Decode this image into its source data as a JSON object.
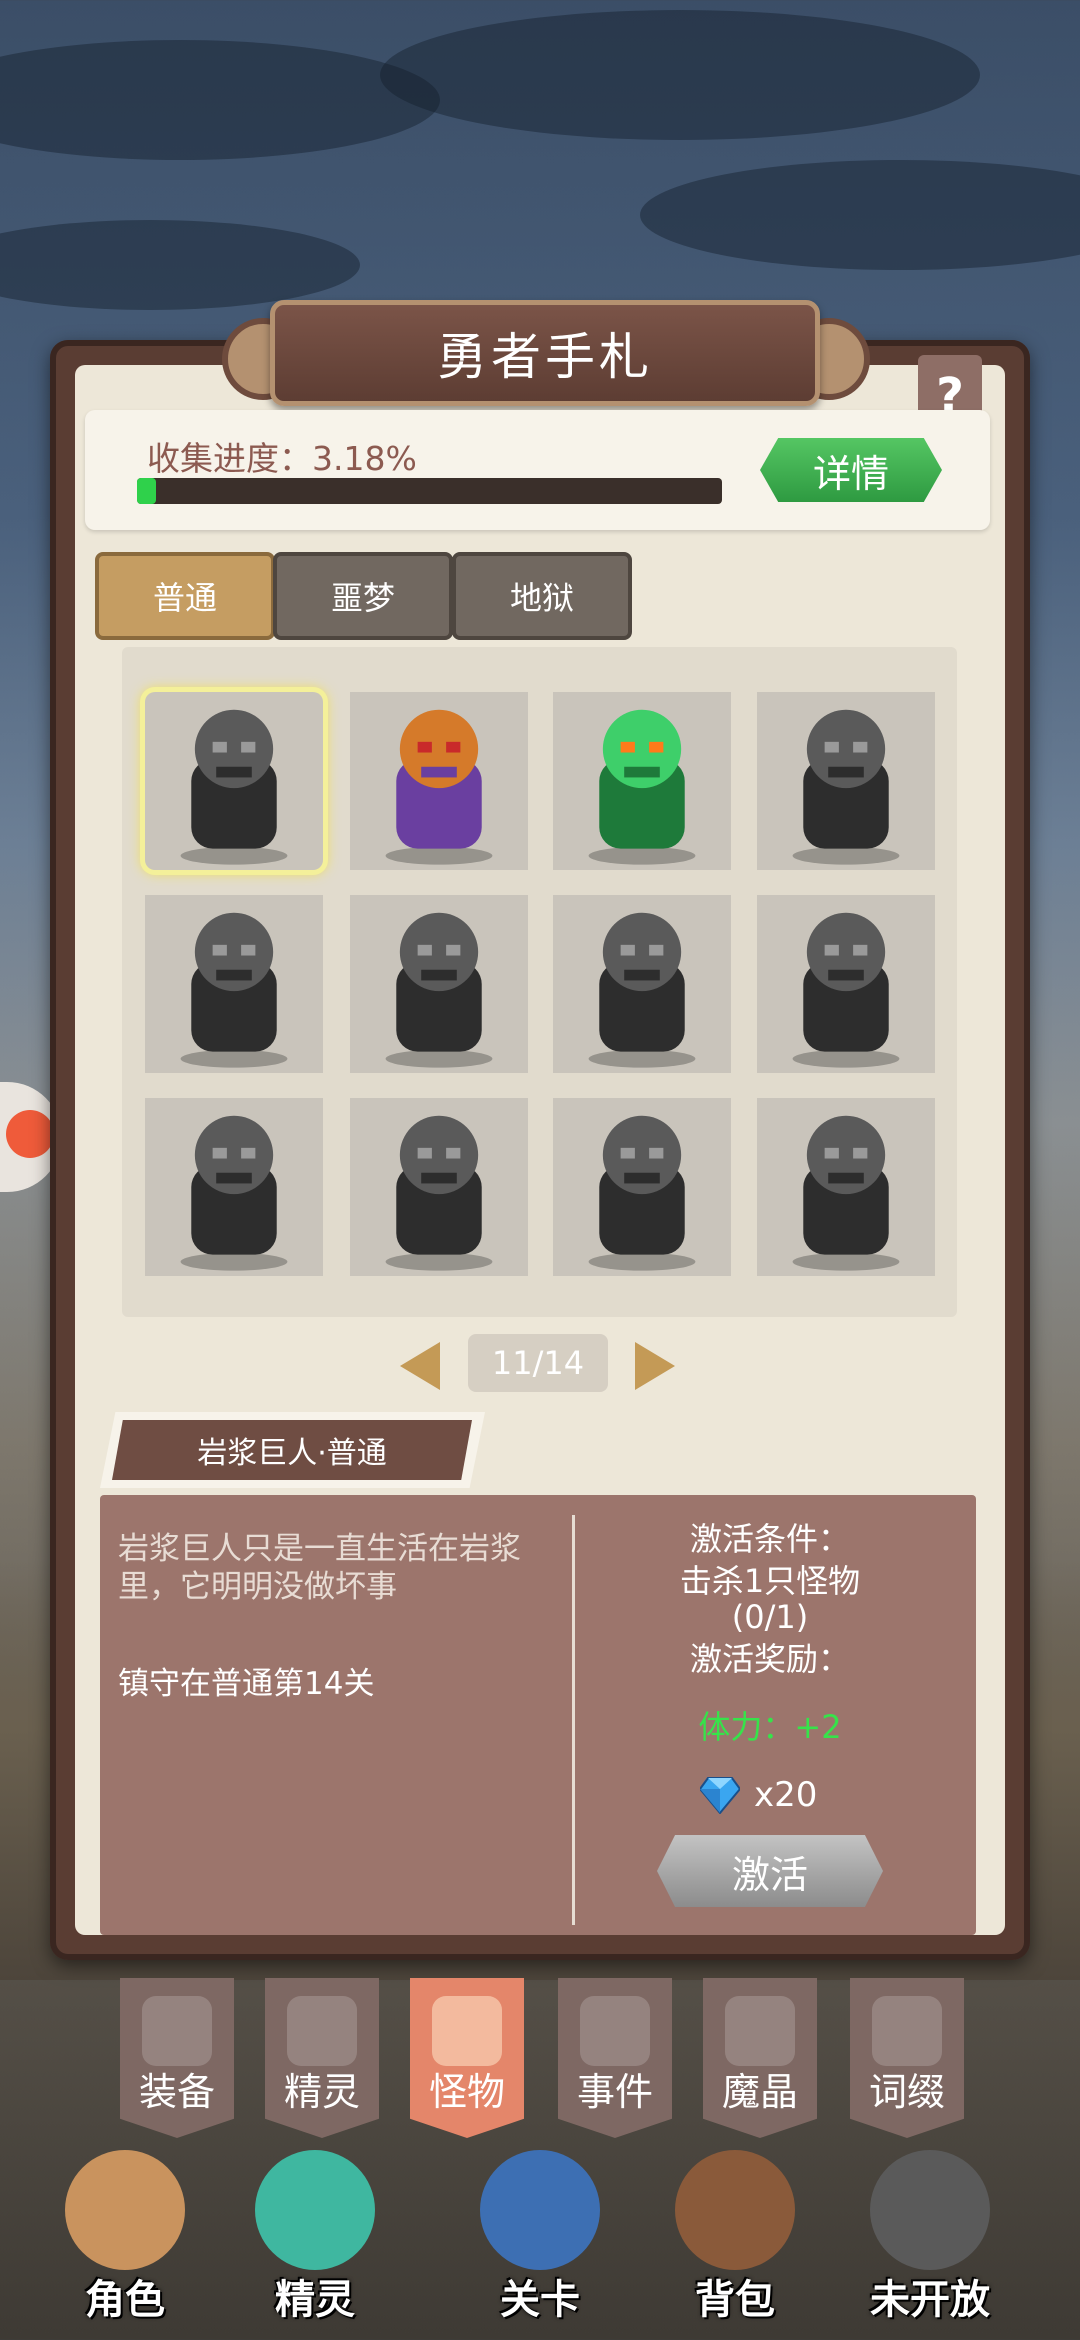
{
  "title": "勇者手札",
  "help_label": "?",
  "progress": {
    "label_prefix": "收集进度：",
    "percent_text": "3.18%",
    "fraction": 0.0318,
    "detail_label": "详情"
  },
  "tabs": [
    {
      "label": "普通",
      "active": true
    },
    {
      "label": "噩梦",
      "active": false
    },
    {
      "label": "地狱",
      "active": false
    }
  ],
  "monsters": [
    {
      "icon": "rock-beast-grey",
      "selected": true,
      "unlocked": false
    },
    {
      "icon": "purple-ogre-color",
      "selected": false,
      "unlocked": true
    },
    {
      "icon": "green-plant-monster-color",
      "selected": false,
      "unlocked": true
    },
    {
      "icon": "ape-warrior-grey",
      "selected": false,
      "unlocked": false
    },
    {
      "icon": "troll-grey",
      "selected": false,
      "unlocked": false
    },
    {
      "icon": "dragon-beast-grey",
      "selected": false,
      "unlocked": false
    },
    {
      "icon": "hooded-reaper-grey",
      "selected": false,
      "unlocked": false
    },
    {
      "icon": "dinosaur-grey",
      "selected": false,
      "unlocked": false
    },
    {
      "icon": "flame-knight-axe-grey",
      "selected": false,
      "unlocked": false
    },
    {
      "icon": "flame-knight-axe-grey-2",
      "selected": false,
      "unlocked": false
    },
    {
      "icon": "dwarf-warrior-grey",
      "selected": false,
      "unlocked": false
    },
    {
      "icon": "stone-golem-grey",
      "selected": false,
      "unlocked": false
    }
  ],
  "pager": {
    "text": "11/14"
  },
  "selected_monster": {
    "name": "岩浆巨人·普通",
    "description": "岩浆巨人只是一直生活在岩浆里，它明明没做坏事",
    "location": "镇守在普通第14关",
    "condition_title": "激活条件：",
    "condition_text": "击杀1只怪物",
    "condition_progress": "(0/1)",
    "reward_title": "激活奖励：",
    "reward_stat": "体力：+2",
    "reward_gem": "x20",
    "activate_label": "激活"
  },
  "categories": [
    {
      "label": "装备",
      "icon": "helmet-icon",
      "active": false
    },
    {
      "label": "精灵",
      "icon": "flame-spirit-icon",
      "active": false
    },
    {
      "label": "怪物",
      "icon": "dragon-head-icon",
      "active": true
    },
    {
      "label": "事件",
      "icon": "scroll-icon",
      "active": false
    },
    {
      "label": "魔晶",
      "icon": "crystal-icon",
      "active": false
    },
    {
      "label": "词缀",
      "icon": "swirl-icon",
      "active": false
    }
  ],
  "bottom_nav": [
    {
      "label": "角色",
      "icon": "hero-avatar-icon"
    },
    {
      "label": "精灵",
      "icon": "slime-spirit-icon"
    },
    {
      "label": "关卡",
      "icon": "swords-gate-icon"
    },
    {
      "label": "背包",
      "icon": "backpack-icon"
    },
    {
      "label": "未开放",
      "icon": "locked-icon"
    }
  ],
  "colors": {
    "accent_green": "#2fd14b",
    "tab_active": "#c59d62",
    "panel_brown": "#5a3d33",
    "info_panel": "#9c756c",
    "category_active": "#e4866a"
  }
}
